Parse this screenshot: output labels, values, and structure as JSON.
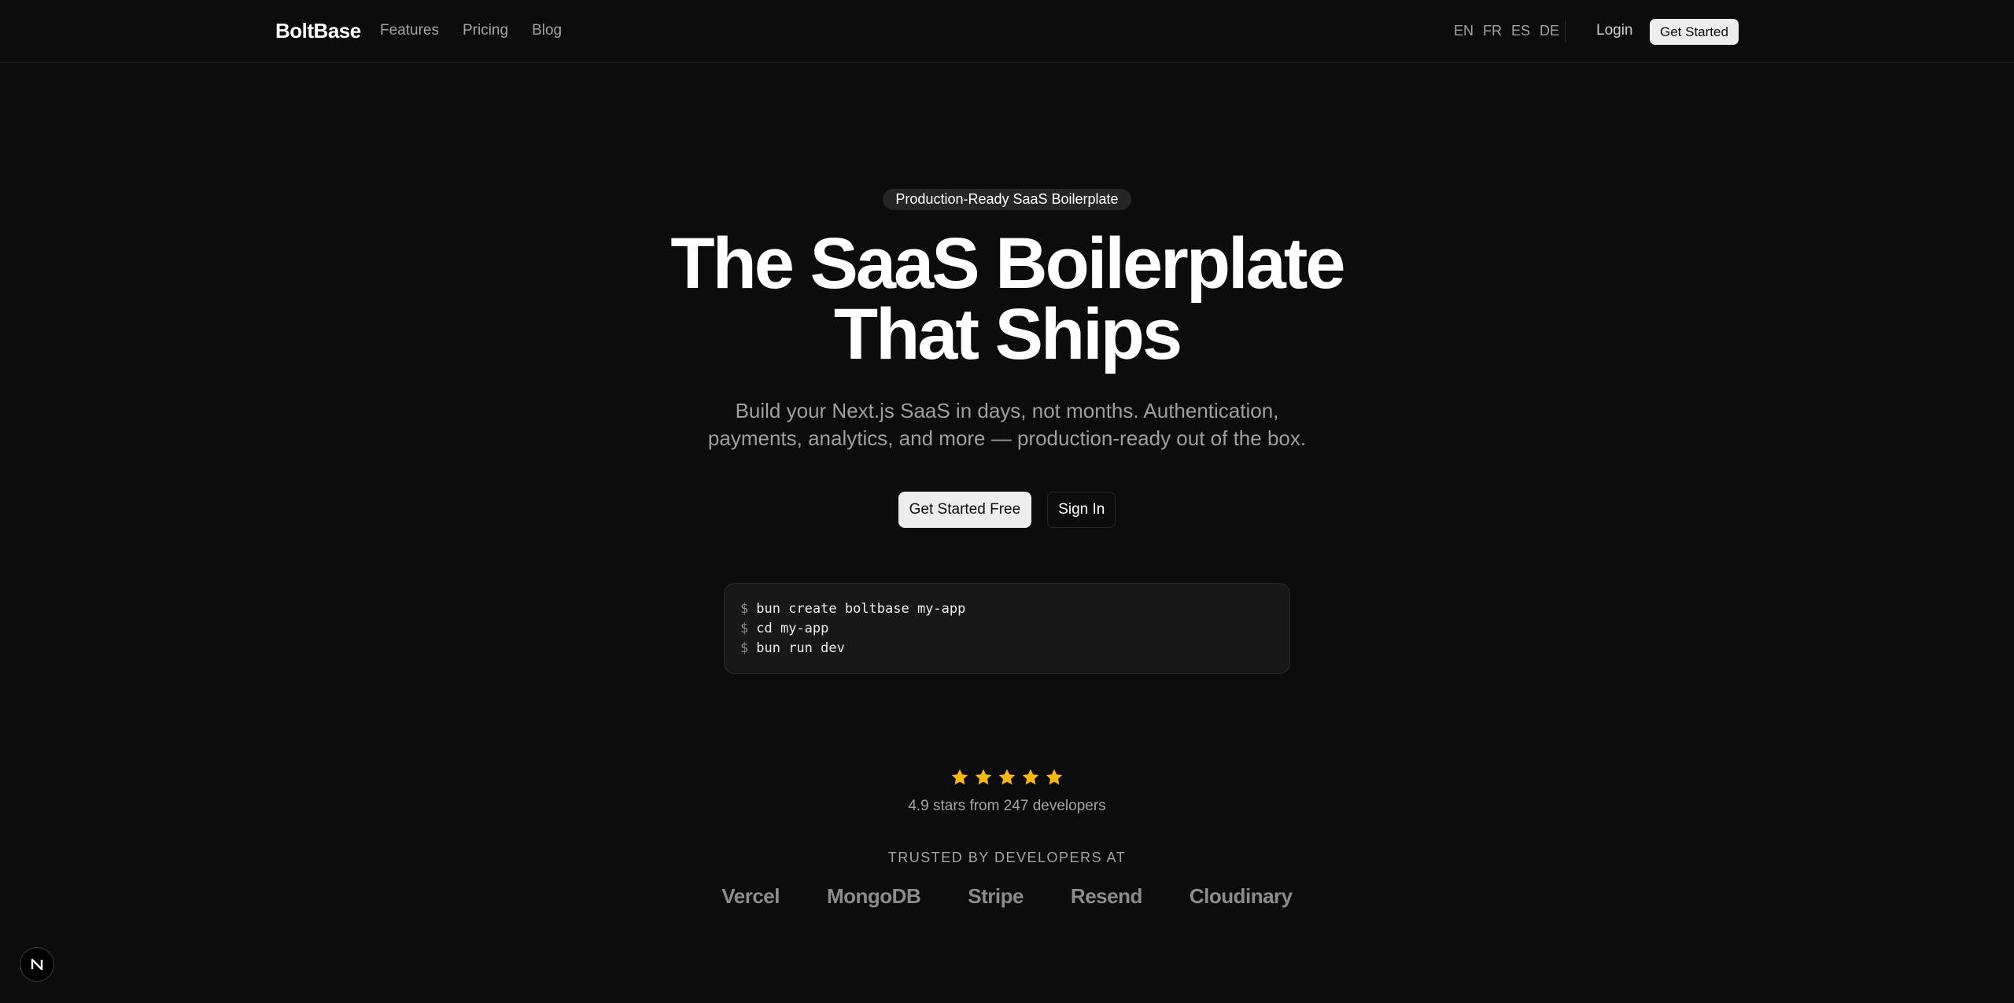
{
  "nav": {
    "brand": "BoltBase",
    "links": [
      "Features",
      "Pricing",
      "Blog"
    ],
    "languages": [
      "EN",
      "FR",
      "ES",
      "DE"
    ],
    "login": "Login",
    "cta": "Get Started"
  },
  "hero": {
    "badge": "Production-Ready SaaS Boilerplate",
    "headline_line1": "The SaaS Boilerplate",
    "headline_line2": "That Ships",
    "subhead_line1": "Build your Next.js SaaS in days, not months. Authentication,",
    "subhead_line2": "payments, analytics, and more — production-ready out of the box.",
    "primary_cta": "Get Started Free",
    "secondary_cta": "Sign In"
  },
  "terminal": {
    "prompt": "$",
    "lines": [
      "bun create boltbase my-app",
      "cd my-app",
      "bun run dev"
    ]
  },
  "rating": {
    "stars": 5,
    "text": "4.9 stars from 247 developers",
    "star_color": "#f5b814"
  },
  "trusted": {
    "label": "TRUSTED BY DEVELOPERS AT",
    "logos": [
      "Vercel",
      "MongoDB",
      "Stripe",
      "Resend",
      "Cloudinary"
    ]
  },
  "dev_badge": {
    "icon": "nextjs-logo-icon",
    "letter": "N"
  }
}
